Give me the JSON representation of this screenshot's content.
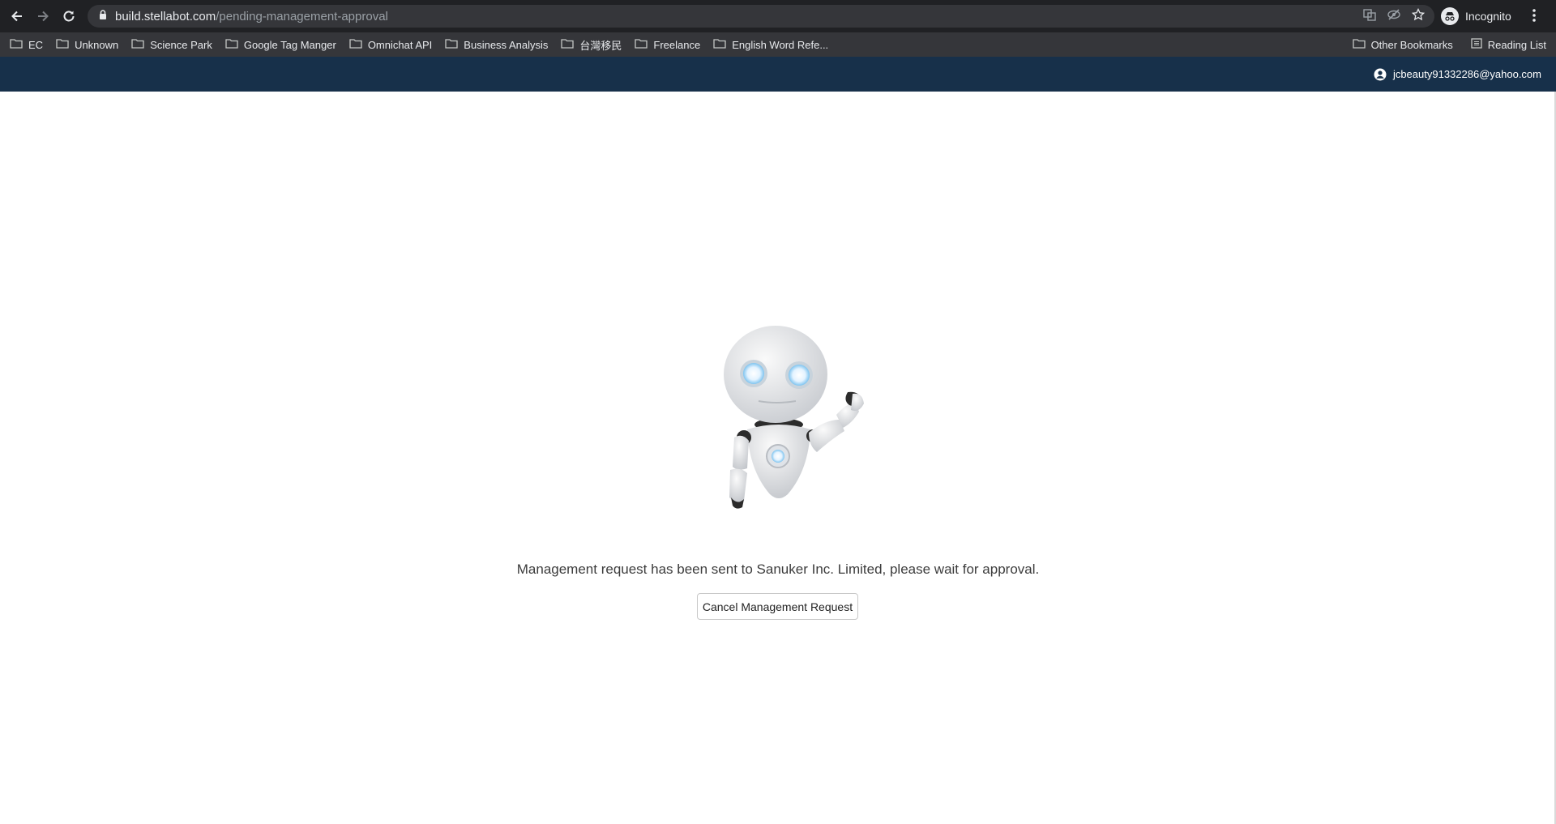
{
  "browser": {
    "url_host": "build.stellabot.com",
    "url_path": "/pending-management-approval",
    "profile_label": "Incognito"
  },
  "bookmarks": {
    "items": [
      {
        "label": "EC"
      },
      {
        "label": "Unknown"
      },
      {
        "label": "Science Park"
      },
      {
        "label": "Google Tag Manger"
      },
      {
        "label": "Omnichat API"
      },
      {
        "label": "Business Analysis"
      },
      {
        "label": "台灣移民"
      },
      {
        "label": "Freelance"
      },
      {
        "label": "English Word Refe..."
      }
    ],
    "other_bookmarks": "Other Bookmarks",
    "reading_list": "Reading List"
  },
  "header": {
    "user_email": "jcbeauty91332286@yahoo.com"
  },
  "main": {
    "message": "Management request has been sent to Sanuker Inc. Limited, please wait for approval.",
    "cancel_button": "Cancel Management Request"
  },
  "colors": {
    "header_bg": "#17304a",
    "chrome_bg": "#202124",
    "bookmarks_bg": "#35363a"
  }
}
